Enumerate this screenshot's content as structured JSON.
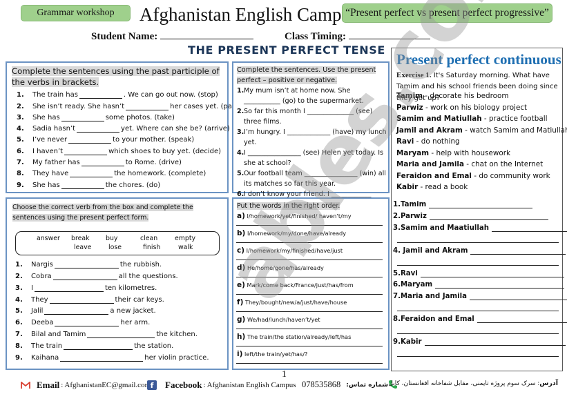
{
  "header": {
    "left_pill": "Grammar workshop",
    "title": "Afghanistan English Campus",
    "right_pill": "“Present perfect vs present perfect progressive”",
    "student_name_label": "Student Name:",
    "class_timing_label": "Class Timing:",
    "tense_heading": "THE PRESENT PERFECT TENSE"
  },
  "exercise1": {
    "instruction": "Complete the sentences using the past participle of the verbs in brackets.",
    "items": [
      {
        "num": "1.",
        "before": "The train has",
        "after": ". We can go out now. (stop)"
      },
      {
        "num": "2.",
        "before": "She isn’t ready. She hasn’t",
        "after": "her cases yet. (pack)"
      },
      {
        "num": "3.",
        "before": "She has",
        "after": "some photos. (take)"
      },
      {
        "num": "4.",
        "before": "Sadia hasn’t",
        "after": "yet. Where can she be? (arrive)"
      },
      {
        "num": "5.",
        "before": "I’ve never",
        "after": "to your mother. (speak)"
      },
      {
        "num": "6.",
        "before": "I haven’t",
        "after": "which shoes to buy yet. (decide)"
      },
      {
        "num": "7.",
        "before": "My father has",
        "after": "to Rome. (drive)"
      },
      {
        "num": "8.",
        "before": "They have",
        "after": "the homework. (complete)"
      },
      {
        "num": "9.",
        "before": "She has",
        "after": "the chores. (do)"
      }
    ]
  },
  "exercise2": {
    "instruction": "Complete the sentences. Use the present perfect – positive or negative.",
    "items": [
      {
        "num": "1.",
        "text": "My mum isn’t at home now. She ___________ (go) to the supermarket."
      },
      {
        "num": "2.",
        "text": "So far this month I ______________ (see) three films."
      },
      {
        "num": "3.",
        "text": "I’m hungry. I _____________ (have) my lunch yet."
      },
      {
        "num": "4.",
        "text": "I ________________ (see) Helen yet today. Is she at school?"
      },
      {
        "num": "5.",
        "text": "Our football team ________________ (win) all its matches so far this year."
      },
      {
        "num": "6.",
        "text": "I don’t know your friend. I ____________ (meet) him yet."
      }
    ]
  },
  "exercise3": {
    "instruction": "Choose the correct verb from the box and complete the sentences using the present perfect form.",
    "verbs_row1": [
      "answer",
      "break",
      "buy",
      "clean",
      "empty"
    ],
    "verbs_row2": [
      "leave",
      "lose",
      "finish",
      "walk"
    ],
    "items": [
      {
        "num": "1.",
        "before": "Nargis",
        "after": "the rubbish."
      },
      {
        "num": "2.",
        "before": "Cobra",
        "after": "all the questions."
      },
      {
        "num": "3.",
        "before": "I",
        "after": "ten kilometres."
      },
      {
        "num": "4.",
        "before": "They",
        "after": "their car keys."
      },
      {
        "num": "5.",
        "before": "Jalil",
        "after": "a new jacket."
      },
      {
        "num": "6.",
        "before": "Deeba",
        "after": "her arm."
      },
      {
        "num": "7.",
        "before": "Bilal and Tamim",
        "after": "the kitchen."
      },
      {
        "num": "8.",
        "before": "The train",
        "after": "the station."
      },
      {
        "num": "9.",
        "before": "Kaihana",
        "after": "her violin practice."
      }
    ]
  },
  "exercise4": {
    "instruction": "Put the words in the right order.",
    "items": [
      {
        "letter": "a)",
        "text": "I/homework/yet/finished/ haven’t/my"
      },
      {
        "letter": "b)",
        "text": "I/homework/my/done/have/already"
      },
      {
        "letter": "c)",
        "text": "I/homework/my/finished/have/just"
      },
      {
        "letter": "d)",
        "text": "He/home/gone/has/already"
      },
      {
        "letter": "e)",
        "text": "Mark/come back/France/just/has/from"
      },
      {
        "letter": "f)",
        "text": "They/bought/new/a/just/have/house"
      },
      {
        "letter": "g)",
        "text": "We/had/lunch/haven’t/yet"
      },
      {
        "letter": "h)",
        "text": "The train/the station/already/left/has"
      },
      {
        "letter": "i)",
        "text": "left/the train/yet/has/?"
      }
    ]
  },
  "continuous": {
    "title": "Present perfect continuous",
    "exercise_label": "Exercise 1.",
    "intro": "It's Saturday morning. What have Tamim and his school friends been doing since they got up?",
    "activities": [
      {
        "who": "Tamim",
        "what": "- decorate his bedroom"
      },
      {
        "who": "Parwiz",
        "what": "- work on his biology project"
      },
      {
        "who": "Samim and Matiullah",
        "what": "- practice football"
      },
      {
        "who": "Jamil and Akram",
        "what": "- watch Samim and Matiullah"
      },
      {
        "who": "Ravi",
        "what": "- do nothing"
      },
      {
        "who": "Maryam",
        "what": "- help with housework"
      },
      {
        "who": "Maria and Jamila",
        "what": "- chat on the Internet"
      },
      {
        "who": "Feraidon and Emal",
        "what": "- do community work"
      },
      {
        "who": "Kabir",
        "what": "- read a book"
      }
    ],
    "answers": [
      "1.Tamim",
      "2.Parwiz",
      "3.Samim and Maatiullah",
      "4.  Jamil and Akram",
      "5.Ravi",
      "6.Maryam",
      "7.Maria and Jamila",
      "8.Feraidon and Emal",
      "9.Kabir"
    ]
  },
  "page_number": "1",
  "footer": {
    "email_label": "Email",
    "email_value": ": AfghanistanEC@gmail.com",
    "facebook_label": "Facebook",
    "facebook_value": ": Afghanistan English Campus",
    "phone_value": "078535868",
    "phone_label": "شماره تماس:",
    "address_label": "آدرس",
    "address_value": ": سرک سوم پروژه تایمنی، مقابل شفاخانه افغانستان، کابل",
    "icons": {
      "email": "gmail-icon",
      "facebook": "facebook-icon",
      "phone": "phone-icon"
    }
  },
  "watermark": "ables.com"
}
